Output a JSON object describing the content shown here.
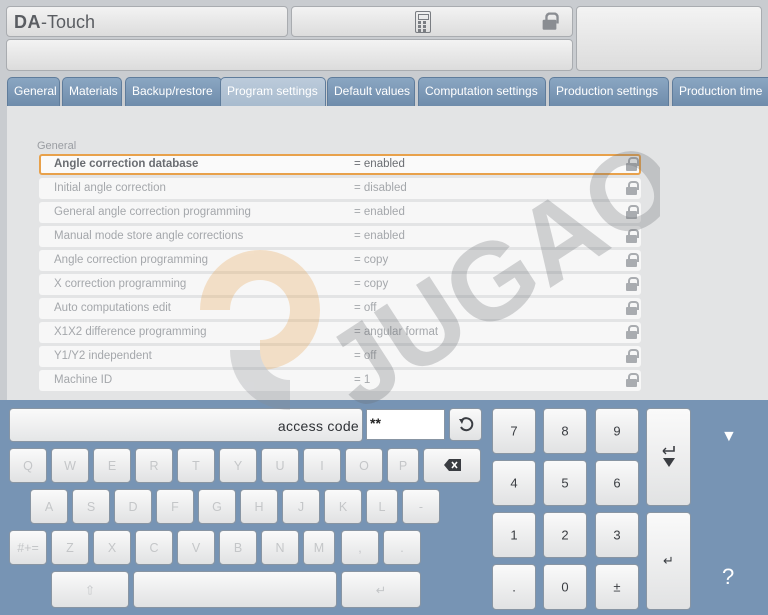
{
  "header": {
    "brand_bold": "DA",
    "brand_rest": "-Touch"
  },
  "tabs": [
    {
      "label": "General"
    },
    {
      "label": "Materials"
    },
    {
      "label": "Backup/restore"
    },
    {
      "label": "Program settings"
    },
    {
      "label": "Default values"
    },
    {
      "label": "Computation settings"
    },
    {
      "label": "Production settings"
    },
    {
      "label": "Production time"
    }
  ],
  "section_label": "General",
  "rows": [
    {
      "label": "Angle correction database",
      "value": "= enabled"
    },
    {
      "label": "Initial angle correction",
      "value": "= disabled"
    },
    {
      "label": "General angle correction programming",
      "value": "= enabled"
    },
    {
      "label": "Manual mode store angle corrections",
      "value": "= enabled"
    },
    {
      "label": "Angle correction programming",
      "value": "= copy"
    },
    {
      "label": "X correction programming",
      "value": "= copy"
    },
    {
      "label": "Auto computations edit",
      "value": "= off"
    },
    {
      "label": "X1X2 difference programming",
      "value": "= angular format"
    },
    {
      "label": "Y1/Y2 independent",
      "value": "= off"
    },
    {
      "label": "Machine ID",
      "value": "= 1"
    }
  ],
  "keyboard": {
    "prompt": "access code",
    "code_value": "**",
    "row1": [
      "Q",
      "W",
      "E",
      "R",
      "T",
      "Y",
      "U",
      "I",
      "O",
      "P"
    ],
    "row2": [
      "A",
      "S",
      "D",
      "F",
      "G",
      "H",
      "J",
      "K",
      "L",
      "-"
    ],
    "row3": [
      "#+=",
      "Z",
      "X",
      "C",
      "V",
      "B",
      "N",
      "M",
      ",",
      "."
    ],
    "shift": "⇧",
    "enter_small": "↵",
    "numpad": [
      "7",
      "8",
      "9",
      "4",
      "5",
      "6",
      "1",
      "2",
      "3",
      ".",
      "0",
      "±"
    ],
    "enter": "↵",
    "collapse": "▼",
    "help": "?"
  },
  "watermark": "JUGAO",
  "colors": {
    "accent_orange": "#e8a14b",
    "tab_blue": "#7794b4",
    "keyboard_bg": "#7794b4"
  }
}
